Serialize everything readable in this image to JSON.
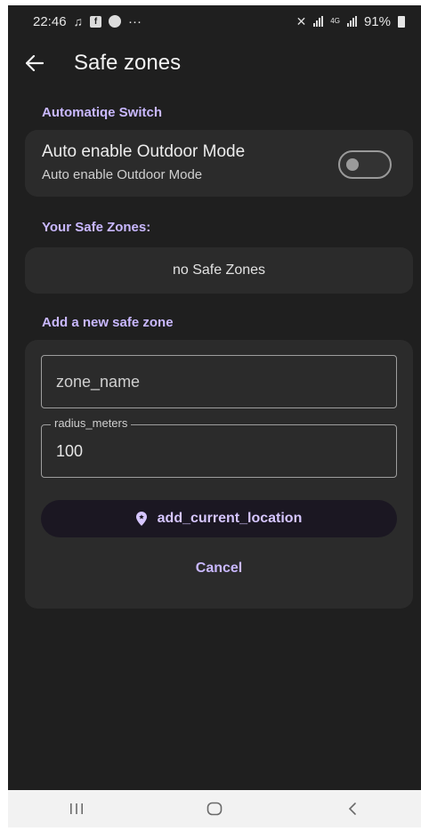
{
  "status_bar": {
    "time": "22:46",
    "more": "···",
    "network": "4G",
    "battery": "91%"
  },
  "app_bar": {
    "back_icon": "arrow-left-icon",
    "title": "Safe zones"
  },
  "automatic_switch": {
    "section_label": "Automatiqe Switch",
    "title": "Auto enable Outdoor Mode",
    "subtitle": "Auto enable Outdoor Mode",
    "enabled": false
  },
  "safe_zones": {
    "section_label": "Your Safe Zones:",
    "empty_text": "no Safe Zones",
    "items": []
  },
  "add_zone": {
    "section_label": "Add a new safe zone",
    "name_placeholder": "zone_name",
    "name_value": "",
    "radius_label": "radius_meters",
    "radius_value": "100",
    "add_location_label": "add_current_location",
    "add_location_icon": "location-pin-icon",
    "cancel_label": "Cancel"
  },
  "nav_bar": {
    "recents_icon": "recents-icon",
    "home_icon": "home-icon",
    "back_icon": "back-chevron-icon"
  },
  "colors": {
    "background": "#1f1f1f",
    "card": "#2b2b2b",
    "accent": "#c9b8ff",
    "button_bg": "#1b1722"
  }
}
